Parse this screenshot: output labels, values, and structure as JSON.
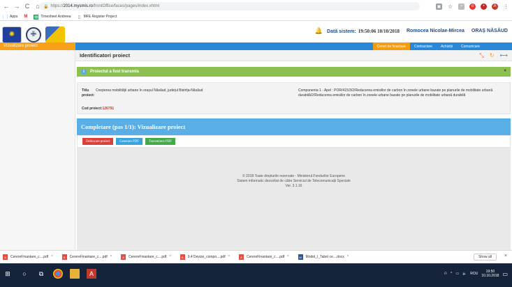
{
  "browser": {
    "url_prefix": "https://",
    "url_host": "2014.mysmis.ro",
    "url_path": "/frontOffice/faces/pages/index.xhtml",
    "bookmarks": [
      {
        "label": "Apps",
        "icon": "apps-grid-icon"
      },
      {
        "label": "",
        "icon": "gmail-icon"
      },
      {
        "label": "Timesheet Andreea",
        "icon": "sheets-icon"
      },
      {
        "label": "MFE Register Project",
        "icon": "page-icon"
      }
    ]
  },
  "header": {
    "sys_label": "Dată sistem:",
    "sys_time": "19:50:06 10/10/2018",
    "user": "Romocea Nicolae-Mircea",
    "town": "ORAȘ NĂSĂUD"
  },
  "topnav": {
    "items": [
      "Cereri de finanțare",
      "Contractare",
      "Achiziții",
      "Comunicare"
    ]
  },
  "sidebar": {
    "items": [
      "Vizualizare proiect"
    ]
  },
  "main": {
    "title": "Identificatori proiect",
    "alert_text": "Proiectul a fost transmis",
    "alert_close": "×",
    "titlu_label": "Titlu proiect:",
    "titlu_value": "Creșterea mobilității urbane în orașul Năsăud, județul Bistrița-Năsăud",
    "cod_label": "Cod proiect:",
    "cod_value": "126791",
    "componenta": "Componenta 1 - Apel : POR/415/3/2/Reducerea emisiilor de carbon în zonele urbane bazate pe planurile de mobilitate urbană durabilă/2/Reducerea emisiilor de carbon în zonele urbane bazate pe planurile de mobilitate urbană durabilă",
    "section_title": "Completare (pas 1/1): Vizualizare proiect",
    "buttons": {
      "deblocare": "Deblocare proiect",
      "generare": "Generare PDF",
      "transmitere": "Transmitere PDF"
    },
    "footer_line1": "© 2018 Toate drepturile rezervate - Ministerul Fondurilor Europene",
    "footer_line2": "Sistem informatic dezvoltat de către Serviciul de Telecomunicații Speciale",
    "footer_line3": "Ver. 3.1.16"
  },
  "downloads": {
    "items": [
      {
        "name": "CerereFinantare_c....pdf",
        "type": "pdf"
      },
      {
        "name": "CerereFinantare_c....pdf",
        "type": "pdf"
      },
      {
        "name": "CerereFinantare_c....pdf",
        "type": "pdf"
      },
      {
        "name": "9.4 Devize_compo....pdf",
        "type": "pdf"
      },
      {
        "name": "CerereFinantare_c....pdf",
        "type": "pdf"
      },
      {
        "name": "Model_I_Tabel ce....docx",
        "type": "docx"
      }
    ],
    "show_all": "Show all"
  },
  "taskbar": {
    "lang": "ROU",
    "time": "19:50",
    "date": "10.10.2018"
  }
}
